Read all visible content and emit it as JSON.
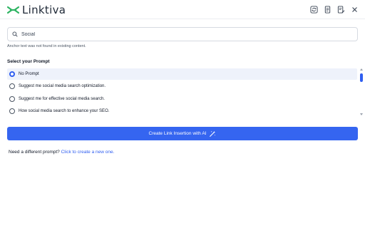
{
  "brand": {
    "name": "Linktiva",
    "logo_color": "#2fb463",
    "accent": "#3565f0"
  },
  "header": {
    "icons": [
      "refresh-icon",
      "document-icon",
      "document-edit-icon",
      "close-icon"
    ]
  },
  "search": {
    "value": "Social",
    "icon": "search-icon"
  },
  "hint": "Anchor text was not found in existing content.",
  "prompts": {
    "title": "Select your Prompt",
    "items": [
      {
        "label": "No Prompt",
        "selected": true
      },
      {
        "label": "Suggest me social media search optimization.",
        "selected": false
      },
      {
        "label": "Suggest me for effective social media search.",
        "selected": false
      },
      {
        "label": "How social media search to enhance your SEO.",
        "selected": false
      }
    ]
  },
  "cta": {
    "label": "Create Link Insertion with AI",
    "icon": "magic-wand-icon"
  },
  "footer": {
    "text": "Need a different prompt?",
    "link": "Click to create a new one."
  }
}
